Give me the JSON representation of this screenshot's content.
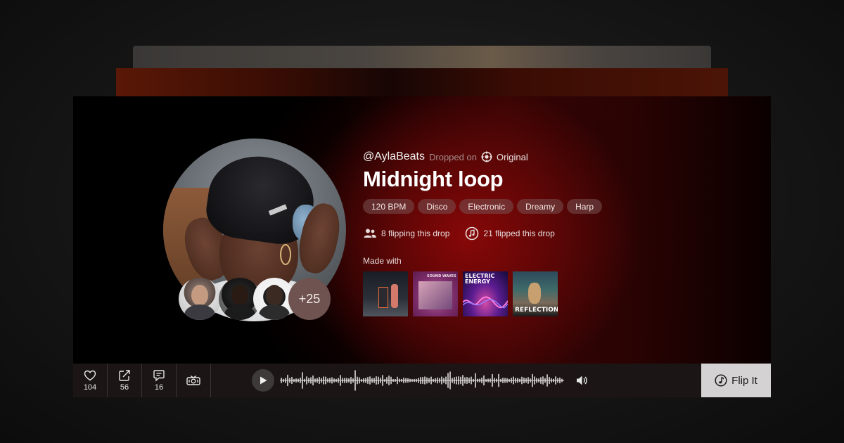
{
  "drop": {
    "handle": "@AylaBeats",
    "dropped_on": "Dropped on",
    "source": "Original",
    "title": "Midnight loop",
    "tags": [
      "120 BPM",
      "Disco",
      "Electronic",
      "Dreamy",
      "Harp"
    ],
    "flipping": "8 flipping this drop",
    "flipped": "21 flipped this drop",
    "made_with_label": "Made with",
    "covers": [
      {
        "caption": ""
      },
      {
        "caption": "SOUND WAVES"
      },
      {
        "caption": "ELECTRIC ENERGY"
      },
      {
        "caption": "REFLECTIONS"
      }
    ],
    "collaborators_more": "+25"
  },
  "actions": {
    "likes": "104",
    "shares": "56",
    "comments": "16"
  },
  "player": {
    "flip_label": "Flip It"
  },
  "colors": {
    "accent_red": "#8c0808",
    "pill_bg": "#785050",
    "flip_bg": "#d4d2d2"
  },
  "icons": [
    "heart-icon",
    "share-icon",
    "comment-icon",
    "radio-icon",
    "play-icon",
    "volume-icon",
    "music-note-icon",
    "users-icon",
    "disc-icon",
    "original-icon"
  ]
}
